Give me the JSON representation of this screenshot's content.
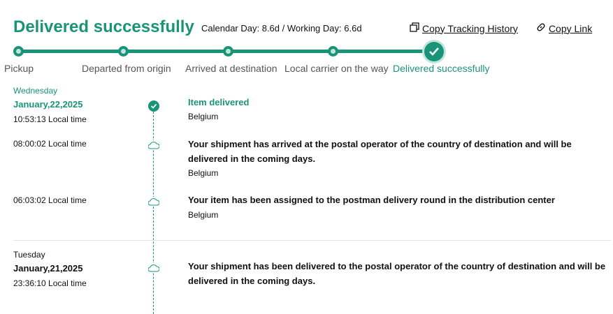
{
  "header": {
    "title": "Delivered successfully",
    "calendar": "Calendar Day: 8.6d / Working Day: 6.6d",
    "copy_history": "Copy Tracking History",
    "copy_link": "Copy Link"
  },
  "stages": [
    "Pickup",
    "Departed from origin",
    "Arrived at destination",
    "Local carrier on the way",
    "Delivered successfully"
  ],
  "days": [
    {
      "weekday": "Wednesday",
      "date": "January,22,2025"
    },
    {
      "weekday": "Tuesday",
      "date": "January,21,2025"
    }
  ],
  "events": [
    {
      "time": "10:53:13 Local time",
      "title": "Item delivered",
      "location": "Belgium"
    },
    {
      "time": "08:00:02 Local time",
      "title": "Your shipment has arrived at the postal operator of the country of destination and will be delivered in the coming days.",
      "location": "Belgium"
    },
    {
      "time": "06:03:02 Local time",
      "title": "Your item has been assigned to the postman delivery round in the distribution center",
      "location": "Belgium"
    },
    {
      "time": "23:36:10 Local time",
      "title": "Your shipment has been delivered to the postal operator of the country of destination and will be delivered in the coming days.",
      "location": ""
    }
  ],
  "colors": {
    "accent": "#1a9478"
  },
  "icons": [
    "copy-icon",
    "link-icon",
    "check-icon",
    "cloud-icon"
  ]
}
